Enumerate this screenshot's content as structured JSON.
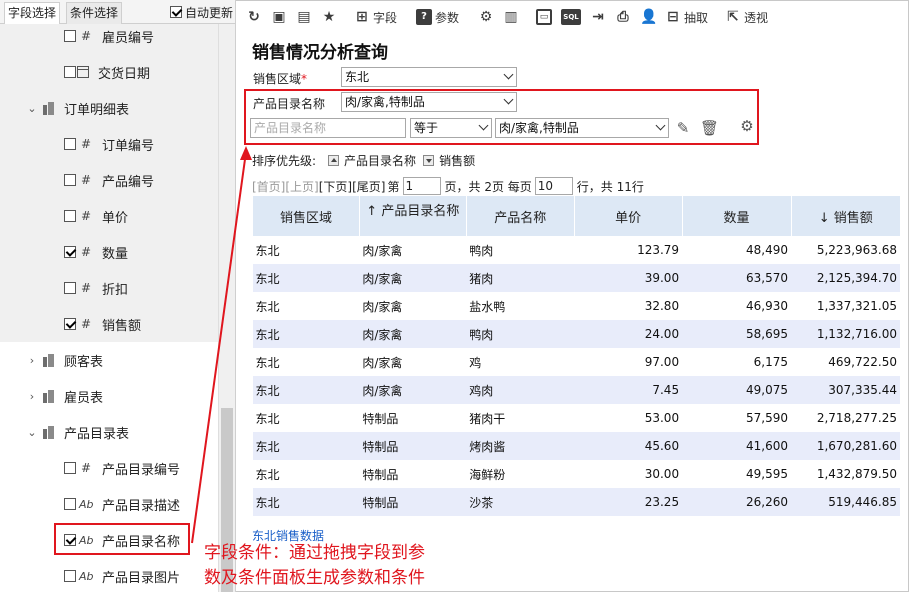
{
  "left_panel": {
    "tabs": [
      "字段选择",
      "条件选择"
    ],
    "auto_update_label": "自动更新",
    "items": [
      {
        "label": "雇员编号",
        "type": "#",
        "checked": false
      },
      {
        "label": "交货日期",
        "type": "date",
        "checked": false
      },
      {
        "label": "订单明细表",
        "type": "table",
        "expanded": true
      },
      {
        "label": "订单编号",
        "type": "#",
        "checked": false
      },
      {
        "label": "产品编号",
        "type": "#",
        "checked": false
      },
      {
        "label": "单价",
        "type": "#",
        "checked": false
      },
      {
        "label": "数量",
        "type": "#",
        "checked": true
      },
      {
        "label": "折扣",
        "type": "#",
        "checked": false
      },
      {
        "label": "销售额",
        "type": "#",
        "checked": true
      },
      {
        "label": "顾客表",
        "type": "table",
        "expanded": false
      },
      {
        "label": "雇员表",
        "type": "table",
        "expanded": false
      },
      {
        "label": "产品目录表",
        "type": "table",
        "expanded": true
      },
      {
        "label": "产品目录编号",
        "type": "#",
        "checked": false
      },
      {
        "label": "产品目录描述",
        "type": "Ab",
        "checked": false
      },
      {
        "label": "产品目录名称",
        "type": "Ab",
        "checked": true
      },
      {
        "label": "产品目录图片",
        "type": "Ab",
        "checked": false
      }
    ]
  },
  "toolbar": {
    "field_label": "字段",
    "param_label": "参数",
    "extract_label": "抽取",
    "pivot_label": "透视",
    "sql_label": "SQL"
  },
  "report": {
    "title": "销售情况分析查询",
    "param1_label": "销售区域",
    "param1_required_mark": "*",
    "param1_value": "东北",
    "param2_label": "产品目录名称",
    "param2_value": "肉/家禽,特制品",
    "cond_field_placeholder": "产品目录名称",
    "cond_operator": "等于",
    "cond_value": "肉/家禽,特制品",
    "sort_label": "排序优先级:",
    "sort_items": [
      "产品目录名称",
      "销售额"
    ],
    "pager": {
      "first": "[首页]",
      "prev": "[上页]",
      "next": "[下页]",
      "last": "[尾页]",
      "page_prefix": "第",
      "page": "1",
      "page_mid": "页，共 2页 每页",
      "per_page": "10",
      "page_suffix": "行，共 11行"
    },
    "columns": [
      "销售区域",
      "产品目录名称",
      "产品名称",
      "单价",
      "数量",
      "销售额"
    ],
    "sort_arrow_up": "↑",
    "sort_arrow_down": "↓",
    "rows": [
      [
        "东北",
        "肉/家禽",
        "鸭肉",
        "123.79",
        "48,490",
        "5,223,963.68"
      ],
      [
        "东北",
        "肉/家禽",
        "猪肉",
        "39.00",
        "63,570",
        "2,125,394.70"
      ],
      [
        "东北",
        "肉/家禽",
        "盐水鸭",
        "32.80",
        "46,930",
        "1,337,321.05"
      ],
      [
        "东北",
        "肉/家禽",
        "鸭肉",
        "24.00",
        "58,695",
        "1,132,716.00"
      ],
      [
        "东北",
        "肉/家禽",
        "鸡",
        "97.00",
        "6,175",
        "469,722.50"
      ],
      [
        "东北",
        "肉/家禽",
        "鸡肉",
        "7.45",
        "49,075",
        "307,335.44"
      ],
      [
        "东北",
        "特制品",
        "猪肉干",
        "53.00",
        "57,590",
        "2,718,277.25"
      ],
      [
        "东北",
        "特制品",
        "烤肉酱",
        "45.60",
        "41,600",
        "1,670,281.60"
      ],
      [
        "东北",
        "特制品",
        "海鲜粉",
        "30.00",
        "49,595",
        "1,432,879.50"
      ],
      [
        "东北",
        "特制品",
        "沙茶",
        "23.25",
        "26,260",
        "519,446.85"
      ]
    ],
    "footer_link": "东北销售数据"
  },
  "callout": {
    "line1": "字段条件：通过拖拽字段到参",
    "line2": "数及条件面板生成参数和条件"
  },
  "colors": {
    "accent_red": "#e0161e",
    "header_bg": "#dde8f5",
    "alt_row": "#e8ecfa",
    "link_blue": "#1a5fc8"
  }
}
